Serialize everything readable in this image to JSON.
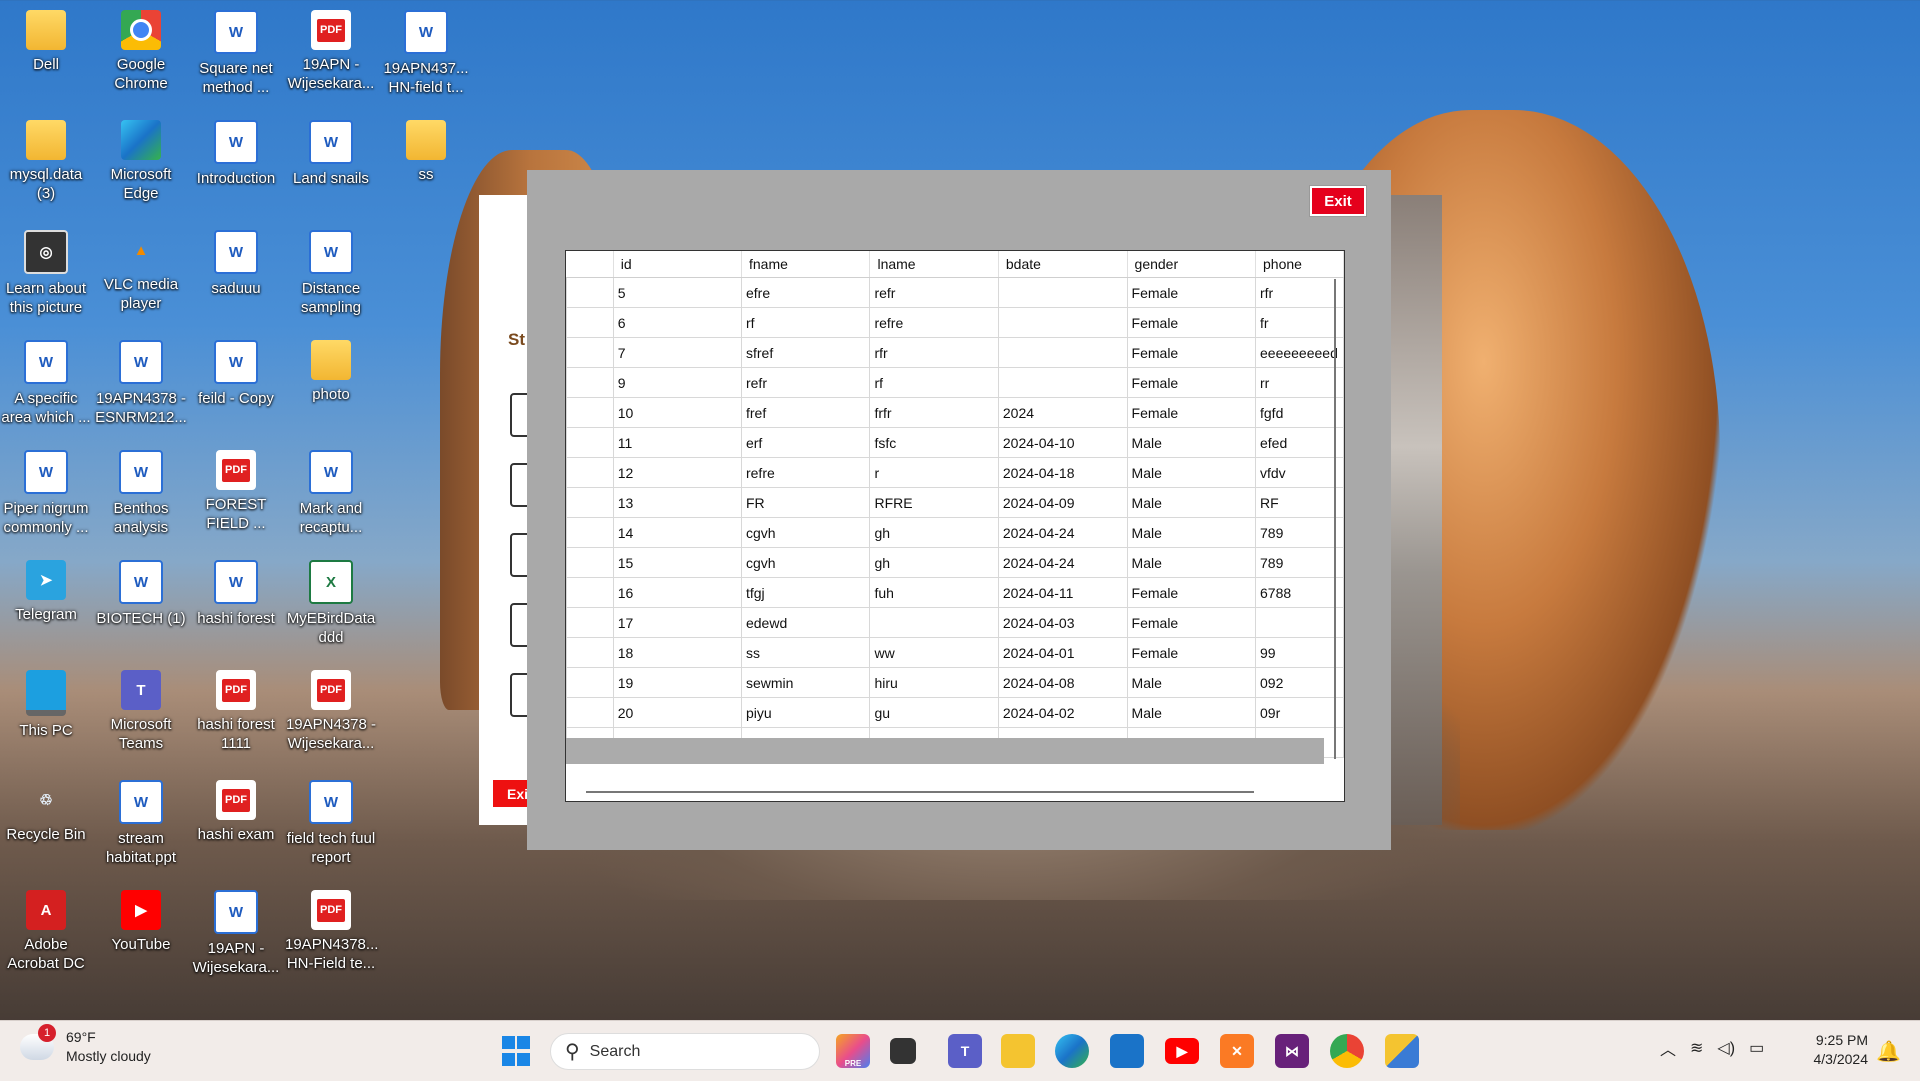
{
  "desktop_icons": [
    {
      "label": "Dell",
      "type": "folder"
    },
    {
      "label": "Google Chrome",
      "type": "chrome"
    },
    {
      "label": "Square net method ...",
      "type": "word"
    },
    {
      "label": "19APN -Wijesekara...",
      "type": "pdf"
    },
    {
      "label": "19APN437... HN-field t...",
      "type": "word"
    },
    {
      "label": "mysql.data (3)",
      "type": "folder"
    },
    {
      "label": "Microsoft Edge",
      "type": "edge"
    },
    {
      "label": "Introduction",
      "type": "word"
    },
    {
      "label": "Land snails",
      "type": "word"
    },
    {
      "label": "ss",
      "type": "folder"
    },
    {
      "label": "Learn about this picture",
      "type": "round"
    },
    {
      "label": "VLC media player",
      "type": "vlc"
    },
    {
      "label": "saduuu",
      "type": "word"
    },
    {
      "label": "Distance sampling",
      "type": "word"
    },
    {
      "label": "A specific area which ...",
      "type": "word"
    },
    {
      "label": "19APN4378 -ESNRM212...",
      "type": "word"
    },
    {
      "label": "feild - Copy",
      "type": "word"
    },
    {
      "label": "photo",
      "type": "folder"
    },
    {
      "label": "Piper nigrum commonly ...",
      "type": "word"
    },
    {
      "label": "Benthos analysis",
      "type": "word"
    },
    {
      "label": "FOREST FIELD ...",
      "type": "pdf"
    },
    {
      "label": "Mark and recaptu...",
      "type": "word"
    },
    {
      "label": "Telegram",
      "type": "telegram"
    },
    {
      "label": "BIOTECH (1)",
      "type": "word"
    },
    {
      "label": "hashi forest",
      "type": "word"
    },
    {
      "label": "MyEBirdData ddd",
      "type": "excel"
    },
    {
      "label": "This PC",
      "type": "pc"
    },
    {
      "label": "Microsoft Teams",
      "type": "teams"
    },
    {
      "label": "hashi forest 1111",
      "type": "pdf"
    },
    {
      "label": "19APN4378 -Wijesekara...",
      "type": "pdf"
    },
    {
      "label": "Recycle Bin",
      "type": "bin"
    },
    {
      "label": "stream habitat.ppt",
      "type": "word"
    },
    {
      "label": "hashi exam",
      "type": "pdf"
    },
    {
      "label": "field tech fuul report",
      "type": "word"
    },
    {
      "label": "Adobe Acrobat DC",
      "type": "acrobat"
    },
    {
      "label": "YouTube",
      "type": "youtube"
    },
    {
      "label": "19APN -Wijesekara...",
      "type": "word"
    },
    {
      "label": "19APN4378... HN-Field te...",
      "type": "pdf"
    }
  ],
  "back_window": {
    "heading_fragment": "St",
    "exit_fragment": "Exi"
  },
  "dialog": {
    "exit_label": "Exit",
    "columns": [
      "id",
      "fname",
      "lname",
      "bdate",
      "gender",
      "phone"
    ],
    "rows": [
      [
        "5",
        "efre",
        "refr",
        "",
        "Female",
        "rfr"
      ],
      [
        "6",
        "rf",
        "refre",
        "",
        "Female",
        "fr"
      ],
      [
        "7",
        "sfref",
        "rfr",
        "",
        "Female",
        "eeeeeeeeed"
      ],
      [
        "9",
        "refr",
        "rf",
        "",
        "Female",
        "rr"
      ],
      [
        "10",
        "fref",
        "frfr",
        "2024",
        "Female",
        "fgfd"
      ],
      [
        "11",
        "erf",
        "fsfc",
        "2024-04-10",
        "Male",
        "efed"
      ],
      [
        "12",
        "refre",
        "r",
        "2024-04-18",
        "Male",
        "vfdv"
      ],
      [
        "13",
        "FR",
        "RFRE",
        "2024-04-09",
        "Male",
        "RF"
      ],
      [
        "14",
        "cgvh",
        "gh",
        "2024-04-24",
        "Male",
        "789"
      ],
      [
        "15",
        "cgvh",
        "gh",
        "2024-04-24",
        "Male",
        "789"
      ],
      [
        "16",
        "tfgj",
        "fuh",
        "2024-04-11",
        "Female",
        "6788"
      ],
      [
        "17",
        "edewd",
        "",
        "2024-04-03",
        "Female",
        ""
      ],
      [
        "18",
        "ss",
        "ww",
        "2024-04-01",
        "Female",
        "99"
      ],
      [
        "19",
        "sewmin",
        "hiru",
        "2024-04-08",
        "Male",
        "092"
      ],
      [
        "20",
        "piyu",
        "gu",
        "2024-04-02",
        "Male",
        "09r"
      ]
    ],
    "new_row_marker": "*"
  },
  "taskbar": {
    "weather_temp": "69°F",
    "weather_desc": "Mostly cloudy",
    "weather_badge": "1",
    "search_placeholder": "Search",
    "pre_label": "PRE",
    "time": "9:25 PM",
    "date": "4/3/2024"
  }
}
